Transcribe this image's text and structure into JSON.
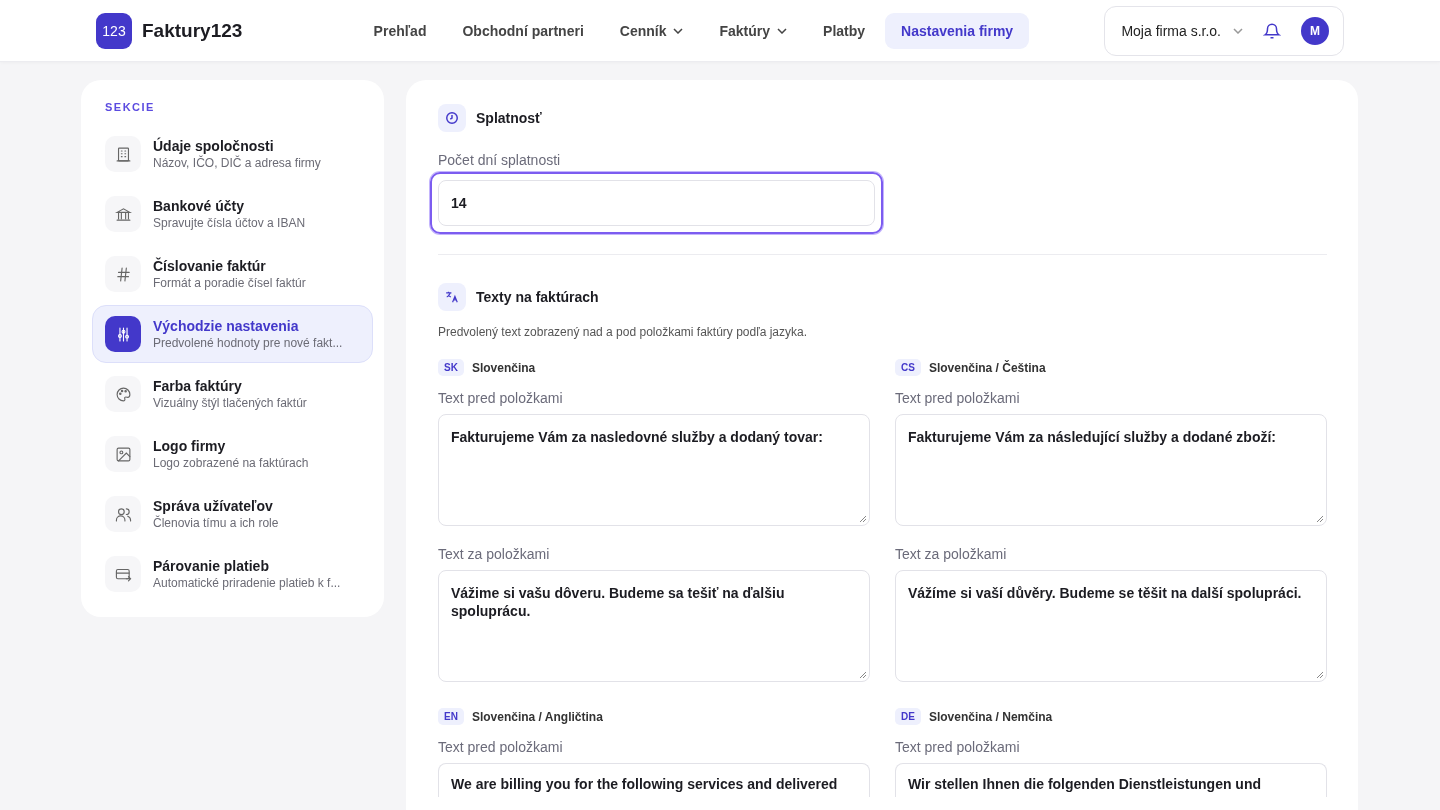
{
  "header": {
    "logo_mark": "123",
    "logo_text": "Faktury123",
    "nav": [
      {
        "label": "Prehľad",
        "selected": false,
        "dropdown": false
      },
      {
        "label": "Obchodní partneri",
        "selected": false,
        "dropdown": false
      },
      {
        "label": "Cenník",
        "selected": false,
        "dropdown": true
      },
      {
        "label": "Faktúry",
        "selected": false,
        "dropdown": true
      },
      {
        "label": "Platby",
        "selected": false,
        "dropdown": false
      },
      {
        "label": "Nastavenia firmy",
        "selected": true,
        "dropdown": false
      }
    ],
    "company": "Moja firma s.r.o.",
    "avatar": "M"
  },
  "sidebar": {
    "heading": "SEKCIE",
    "items": [
      {
        "title": "Údaje spoločnosti",
        "subtitle": "Názov, IČO, DIČ a adresa firmy",
        "selected": false
      },
      {
        "title": "Bankové účty",
        "subtitle": "Spravujte čísla účtov a IBAN",
        "selected": false
      },
      {
        "title": "Číslovanie faktúr",
        "subtitle": "Formát a poradie čísel faktúr",
        "selected": false
      },
      {
        "title": "Východzie nastavenia",
        "subtitle": "Predvolené hodnoty pre nové fakt...",
        "selected": true
      },
      {
        "title": "Farba faktúry",
        "subtitle": "Vizuálny štýl tlačených faktúr",
        "selected": false
      },
      {
        "title": "Logo firmy",
        "subtitle": "Logo zobrazené na faktúrach",
        "selected": false
      },
      {
        "title": "Správa užívateľov",
        "subtitle": "Členovia tímu a ich role",
        "selected": false
      },
      {
        "title": "Párovanie platieb",
        "subtitle": "Automatické priradenie platieb k f...",
        "selected": false
      }
    ]
  },
  "due": {
    "title": "Splatnosť",
    "field_label": "Počet dní splatnosti",
    "value": "14",
    "focused": true
  },
  "texts": {
    "title": "Texty na faktúrach",
    "description": "Predvolený text zobrazený nad a pod položkami faktúry podľa jazyka.",
    "languages": [
      {
        "code": "SK",
        "name": "Slovenčina",
        "before_label": "Text pred položkami",
        "before": "Fakturujeme Vám za nasledovné služby a dodaný tovar:",
        "after_label": "Text za položkami",
        "after": "Vážime si vašu dôveru. Budeme sa tešiť na ďalšiu spoluprácu."
      },
      {
        "code": "CS",
        "name": "Slovenčina / Čeština",
        "before_label": "Text pred položkami",
        "before": "Fakturujeme Vám za následující služby a dodané zboží:",
        "after_label": "Text za položkami",
        "after": "Vážíme si vaší důvěry. Budeme se těšit na další spolupráci."
      },
      {
        "code": "EN",
        "name": "Slovenčina / Angličtina",
        "before_label": "Text pred položkami",
        "before": "We are billing you for the following services and delivered"
      },
      {
        "code": "DE",
        "name": "Slovenčina / Nemčina",
        "before_label": "Text pred položkami",
        "before": "Wir stellen Ihnen die folgenden Dienstleistungen und"
      }
    ]
  }
}
